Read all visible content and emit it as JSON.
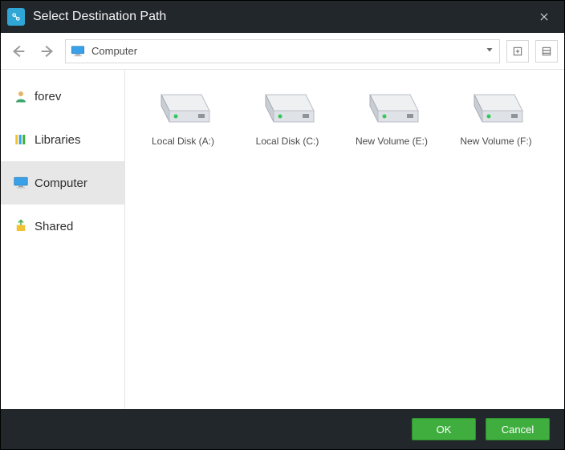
{
  "titlebar": {
    "title": "Select Destination Path"
  },
  "nav": {
    "path_label": "Computer"
  },
  "sidebar": {
    "items": [
      {
        "label": "forev"
      },
      {
        "label": "Libraries"
      },
      {
        "label": "Computer"
      },
      {
        "label": "Shared"
      }
    ]
  },
  "drives": [
    {
      "label": "Local Disk (A:)"
    },
    {
      "label": "Local Disk (C:)"
    },
    {
      "label": "New Volume (E:)"
    },
    {
      "label": "New Volume (F:)"
    }
  ],
  "footer": {
    "ok": "OK",
    "cancel": "Cancel"
  }
}
